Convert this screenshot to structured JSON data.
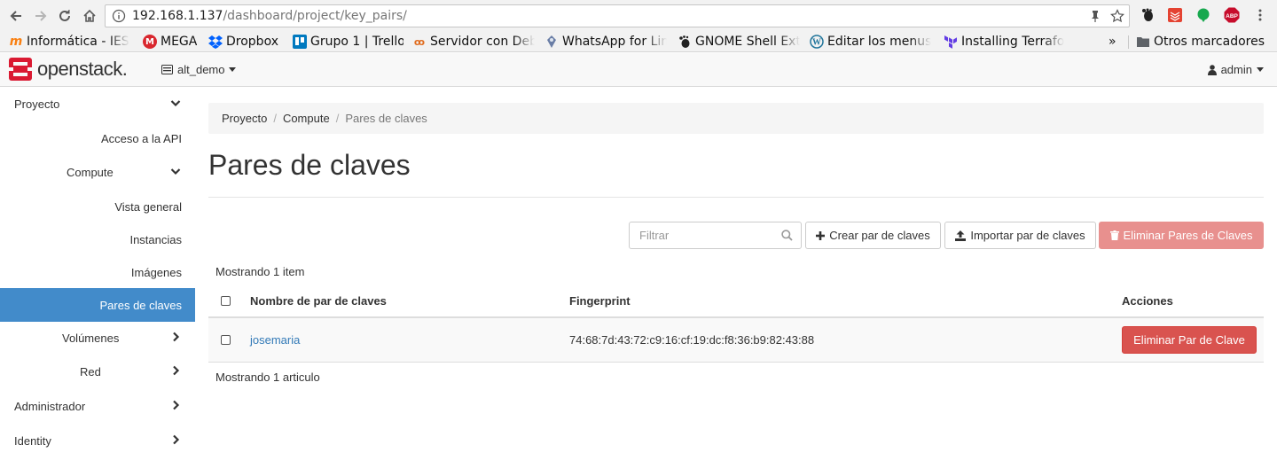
{
  "browser": {
    "url_host": "192.168.1.137",
    "url_path": "/dashboard/project/key_pairs/",
    "bookmarks": [
      {
        "label": "Informática - IES"
      },
      {
        "label": "MEGA"
      },
      {
        "label": "Dropbox"
      },
      {
        "label": "Grupo 1 | Trello"
      },
      {
        "label": "Servidor con Deb"
      },
      {
        "label": "WhatsApp for Lin"
      },
      {
        "label": "GNOME Shell Ext"
      },
      {
        "label": "Editar los menus"
      },
      {
        "label": "Installing Terrafo"
      }
    ],
    "overflow": "»",
    "other_bookmarks": "Otros marcadores",
    "extensions": {
      "abp": "ABP"
    }
  },
  "header": {
    "logo_text": "openstack.",
    "project": "alt_demo",
    "user": "admin"
  },
  "sidebar": {
    "items": [
      {
        "label": "Proyecto"
      },
      {
        "label": "Acceso a la API"
      },
      {
        "label": "Compute"
      },
      {
        "label": "Vista general"
      },
      {
        "label": "Instancias"
      },
      {
        "label": "Imágenes"
      },
      {
        "label": "Pares de claves"
      },
      {
        "label": "Volúmenes"
      },
      {
        "label": "Red"
      },
      {
        "label": "Administrador"
      },
      {
        "label": "Identity"
      }
    ]
  },
  "breadcrumb": [
    "Proyecto",
    "Compute",
    "Pares de claves"
  ],
  "page_title": "Pares de claves",
  "toolbar": {
    "filter_placeholder": "Filtrar",
    "create": "Crear par de claves",
    "import": "Importar par de claves",
    "delete": "Eliminar Pares de Claves"
  },
  "table": {
    "showing_top": "Mostrando 1 item",
    "showing_bottom": "Mostrando 1 articulo",
    "columns": [
      "Nombre de par de claves",
      "Fingerprint",
      "Acciones"
    ],
    "rows": [
      {
        "name": "josemaria",
        "fingerprint": "74:68:7d:43:72:c9:16:cf:19:dc:f8:36:b9:82:43:88",
        "action": "Eliminar Par de Clave"
      }
    ]
  },
  "colors": {
    "accent": "#428bca",
    "danger": "#d9534f",
    "danger_disabled": "#e8908e",
    "link": "#337ab7",
    "logo_red": "#da1a32"
  }
}
